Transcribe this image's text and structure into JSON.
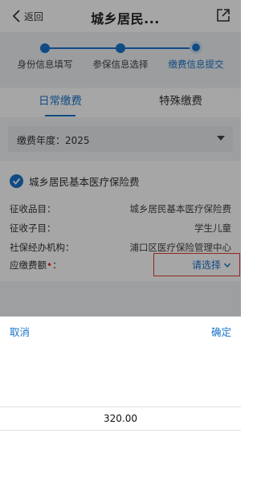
{
  "header": {
    "back_label": "返回",
    "title": "城乡居民...",
    "back_icon": "chevron-left-icon",
    "share_icon": "share-icon"
  },
  "steps": [
    {
      "label": "身份信息填写",
      "state": "done"
    },
    {
      "label": "参保信息选择",
      "state": "done"
    },
    {
      "label": "缴费信息提交",
      "state": "current"
    }
  ],
  "tabs": [
    {
      "label": "日常缴费",
      "active": true
    },
    {
      "label": "特殊缴费",
      "active": false
    }
  ],
  "year_select": {
    "label": "缴费年度：2025"
  },
  "insurance": {
    "checked": true,
    "label": "城乡居民基本医疗保险费"
  },
  "info": {
    "item_key": "征收品目：",
    "item_val": "城乡居民基本医疗保险费",
    "subitem_key": "征收子目：",
    "subitem_val": "学生儿童",
    "agency_key": "社保经办机构：",
    "agency_val": "浦口区医疗保险管理中心",
    "amount_key": "应缴费额",
    "amount_required_mark": "•",
    "amount_colon": "：",
    "amount_select": "请选择"
  },
  "picker": {
    "cancel_label": "取消",
    "confirm_label": "确定",
    "options": [
      "320.00"
    ]
  },
  "colors": {
    "accent": "#1a73c9",
    "required": "#e53935",
    "highlight_box": "#e53935"
  }
}
